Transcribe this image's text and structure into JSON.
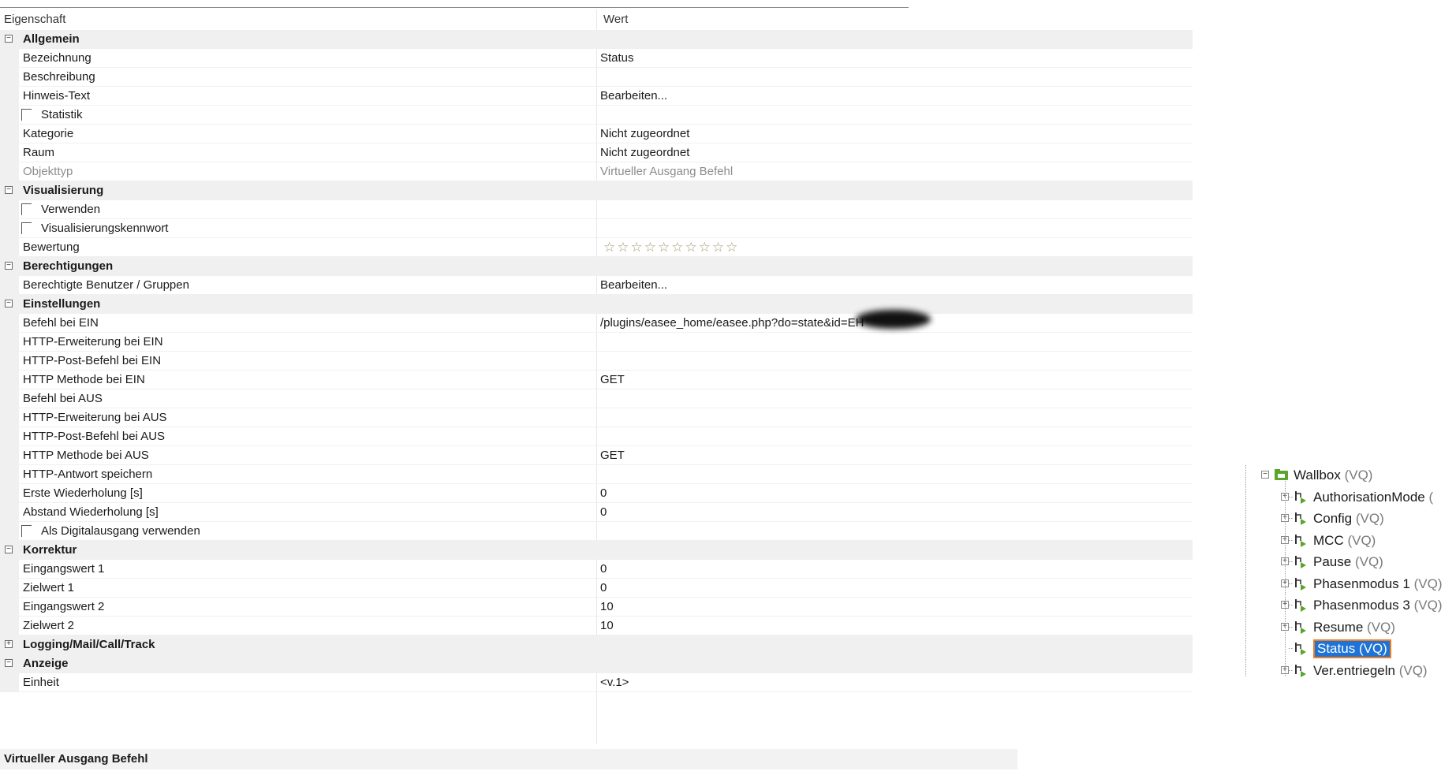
{
  "grid": {
    "header": {
      "property": "Eigenschaft",
      "value": "Wert"
    },
    "rows": [
      {
        "kind": "cat",
        "label": "Allgemein",
        "expander": "⊟"
      },
      {
        "kind": "prop",
        "label": "Bezeichnung",
        "value": "Status"
      },
      {
        "kind": "prop",
        "label": "Beschreibung",
        "value": ""
      },
      {
        "kind": "prop",
        "label": "Hinweis-Text",
        "value": "Bearbeiten..."
      },
      {
        "kind": "check",
        "label": "Statistik",
        "value": ""
      },
      {
        "kind": "prop",
        "label": "Kategorie",
        "value": "Nicht zugeordnet"
      },
      {
        "kind": "prop",
        "label": "Raum",
        "value": "Nicht zugeordnet"
      },
      {
        "kind": "prop",
        "label": "Objekttyp",
        "value": "Virtueller Ausgang Befehl",
        "muted": true
      },
      {
        "kind": "cat",
        "label": "Visualisierung",
        "expander": "⊟"
      },
      {
        "kind": "check",
        "label": "Verwenden",
        "value": ""
      },
      {
        "kind": "check",
        "label": "Visualisierungskennwort",
        "value": ""
      },
      {
        "kind": "stars",
        "label": "Bewertung",
        "value": "☆☆☆☆☆☆☆☆☆☆",
        "rating": 0,
        "max": 10
      },
      {
        "kind": "cat",
        "label": "Berechtigungen",
        "expander": "⊟"
      },
      {
        "kind": "prop",
        "label": "Berechtigte Benutzer / Gruppen",
        "value": "Bearbeiten..."
      },
      {
        "kind": "cat",
        "label": "Einstellungen",
        "expander": "⊟"
      },
      {
        "kind": "prop",
        "label": "Befehl bei EIN",
        "value": "/plugins/easee_home/easee.php?do=state&id=EH"
      },
      {
        "kind": "prop",
        "label": "HTTP-Erweiterung bei EIN",
        "value": ""
      },
      {
        "kind": "prop",
        "label": "HTTP-Post-Befehl bei EIN",
        "value": ""
      },
      {
        "kind": "prop",
        "label": "HTTP Methode bei EIN",
        "value": "GET"
      },
      {
        "kind": "prop",
        "label": "Befehl bei AUS",
        "value": ""
      },
      {
        "kind": "prop",
        "label": "HTTP-Erweiterung bei AUS",
        "value": ""
      },
      {
        "kind": "prop",
        "label": "HTTP-Post-Befehl bei AUS",
        "value": ""
      },
      {
        "kind": "prop",
        "label": "HTTP Methode bei AUS",
        "value": "GET"
      },
      {
        "kind": "prop",
        "label": "HTTP-Antwort speichern",
        "value": ""
      },
      {
        "kind": "prop",
        "label": "Erste Wiederholung [s]",
        "value": "0"
      },
      {
        "kind": "prop",
        "label": "Abstand Wiederholung [s]",
        "value": "0"
      },
      {
        "kind": "check",
        "label": "Als Digitalausgang verwenden",
        "value": ""
      },
      {
        "kind": "cat",
        "label": "Korrektur",
        "expander": "⊟"
      },
      {
        "kind": "prop",
        "label": "Eingangswert 1",
        "value": "0"
      },
      {
        "kind": "prop",
        "label": "Zielwert 1",
        "value": "0"
      },
      {
        "kind": "prop",
        "label": "Eingangswert 2",
        "value": "10"
      },
      {
        "kind": "prop",
        "label": "Zielwert 2",
        "value": "10"
      },
      {
        "kind": "cat",
        "label": "Logging/Mail/Call/Track",
        "expander": "⊞"
      },
      {
        "kind": "cat",
        "label": "Anzeige",
        "expander": "⊟"
      },
      {
        "kind": "prop",
        "label": "Einheit",
        "value": "<v.1>"
      }
    ]
  },
  "status_bar": {
    "text": "Virtueller Ausgang Befehl"
  },
  "tree": {
    "root": {
      "name": "Wallbox",
      "suffix": "(VQ)",
      "expander": "⊟"
    },
    "children": [
      {
        "name": "AuthorisationMode",
        "suffix": "(",
        "expander": "⊞"
      },
      {
        "name": "Config",
        "suffix": "(VQ)",
        "expander": "⊞"
      },
      {
        "name": "MCC",
        "suffix": "(VQ)",
        "expander": "⊞"
      },
      {
        "name": "Pause",
        "suffix": "(VQ)",
        "expander": "⊞"
      },
      {
        "name": "Phasenmodus 1",
        "suffix": "(VQ)",
        "expander": "⊞"
      },
      {
        "name": "Phasenmodus 3",
        "suffix": "(VQ)",
        "expander": "⊞"
      },
      {
        "name": "Resume",
        "suffix": "(VQ)",
        "expander": "⊞"
      },
      {
        "name": "Status",
        "suffix": "(VQ)",
        "expander": "",
        "selected": true
      },
      {
        "name": "Ver.entriegeln",
        "suffix": "(VQ)",
        "expander": "⊞"
      }
    ]
  },
  "colors": {
    "category_bg": "#f0f0f0",
    "selection": "#1e73d6",
    "selection_border": "#f07d1f",
    "folder_green": "#5aa52a"
  }
}
